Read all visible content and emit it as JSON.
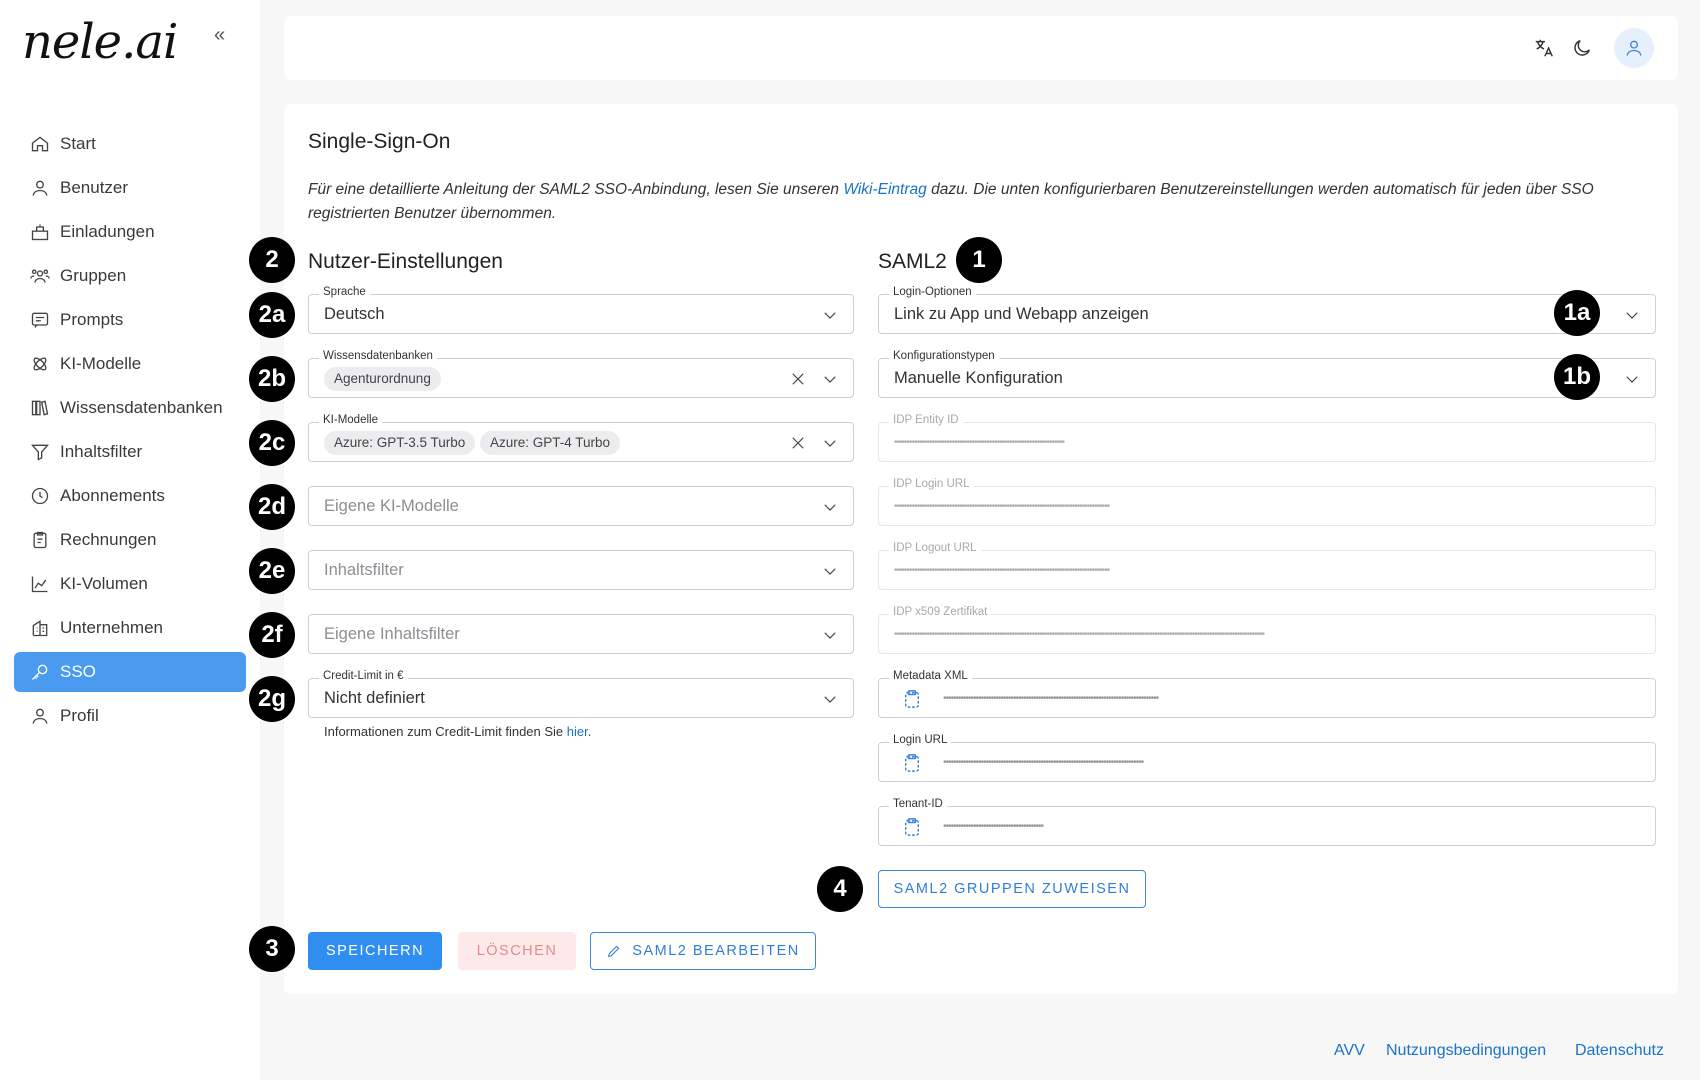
{
  "app": {
    "logo_text": "nele.ai",
    "collapse_glyph": "«"
  },
  "sidebar": {
    "items": [
      {
        "label": "Start",
        "icon": "home-icon"
      },
      {
        "label": "Benutzer",
        "icon": "user-icon"
      },
      {
        "label": "Einladungen",
        "icon": "invite-icon"
      },
      {
        "label": "Gruppen",
        "icon": "group-icon"
      },
      {
        "label": "Prompts",
        "icon": "prompt-icon"
      },
      {
        "label": "KI-Modelle",
        "icon": "model-icon"
      },
      {
        "label": "Wissensdatenbanken",
        "icon": "books-icon"
      },
      {
        "label": "Inhaltsfilter",
        "icon": "filter-icon"
      },
      {
        "label": "Abonnements",
        "icon": "clock-icon"
      },
      {
        "label": "Rechnungen",
        "icon": "invoice-icon"
      },
      {
        "label": "KI-Volumen",
        "icon": "chart-icon"
      },
      {
        "label": "Unternehmen",
        "icon": "building-icon"
      },
      {
        "label": "SSO",
        "icon": "key-icon",
        "active": true
      },
      {
        "label": "Profil",
        "icon": "profile-icon"
      }
    ]
  },
  "topbar": {
    "icons": [
      "translate-icon",
      "moon-icon",
      "user-avatar-icon"
    ]
  },
  "page": {
    "title": "Single-Sign-On",
    "desc_before": "Für eine detaillierte Anleitung der SAML2 SSO-Anbindung, lesen Sie unseren ",
    "desc_link": "Wiki-Eintrag",
    "desc_after": " dazu. Die unten konfigurierbaren Benutzereinstellungen werden automatisch für jeden über SSO registrierten Benutzer übernommen."
  },
  "user_settings": {
    "title": "Nutzer-Einstellungen",
    "sprache": {
      "label": "Sprache",
      "value": "Deutsch"
    },
    "wissensdatenbanken": {
      "label": "Wissensdatenbanken",
      "chips": [
        "Agenturordnung"
      ]
    },
    "ki_modelle": {
      "label": "KI-Modelle",
      "chips": [
        "Azure: GPT-3.5 Turbo",
        "Azure: GPT-4 Turbo"
      ]
    },
    "eigene_ki_modelle": {
      "placeholder": "Eigene KI-Modelle"
    },
    "inhaltsfilter": {
      "placeholder": "Inhaltsfilter"
    },
    "eigene_inhaltsfilter": {
      "placeholder": "Eigene Inhaltsfilter"
    },
    "credit_limit": {
      "label": "Credit-Limit in €",
      "value": "Nicht definiert"
    },
    "helper_before": "Informationen zum Credit-Limit finden Sie ",
    "helper_link": "hier",
    "helper_after": "."
  },
  "saml2": {
    "title": "SAML2",
    "login_optionen": {
      "label": "Login-Optionen",
      "value": "Link zu App und Webapp anzeigen"
    },
    "konfigurationstypen": {
      "label": "Konfigurationstypen",
      "value": "Manuelle Konfiguration"
    },
    "idp_entity_id": {
      "label": "IDP Entity ID",
      "value": "••••••••••••••••••••••••••••••••••••••••••••••••••••••••••••••••••••"
    },
    "idp_login_url": {
      "label": "IDP Login URL",
      "value": "••••••••••••••••••••••••••••••••••••••••••••••••••••••••••••••••••••••••••••••••••••••"
    },
    "idp_logout_url": {
      "label": "IDP Logout URL",
      "value": "••••••••••••••••••••••••••••••••••••••••••••••••••••••••••••••••••••••••••••••••••••••"
    },
    "idp_x509": {
      "label": "IDP x509 Zertifikat",
      "value": "••••••••••••••••••••••••••••••••••••••••••••••••••••••••••••••••••••••••••••••••••••••••••••••••••••••••••••••••••••••••••••••••••••••••••••••••••••"
    },
    "metadata_xml": {
      "label": "Metadata XML",
      "value": "••••••••••••••••••••••••••••••••••••••••••••••••••••••••••••••••••••••••••••••••••••••"
    },
    "login_url": {
      "label": "Login URL",
      "value": "••••••••••••••••••••••••••••••••••••••••••••••••••••••••••••••••••••••••••••••••"
    },
    "tenant_id": {
      "label": "Tenant-ID",
      "value": "••••••••••••••••••••••••••••••••••••••••"
    }
  },
  "buttons": {
    "assign_groups": "SAML2 GRUPPEN ZUWEISEN",
    "save": "SPEICHERN",
    "delete": "LÖSCHEN",
    "edit_saml2": "SAML2 BEARBEITEN"
  },
  "badges": {
    "b1": "1",
    "b1a": "1a",
    "b1b": "1b",
    "b2": "2",
    "b2a": "2a",
    "b2b": "2b",
    "b2c": "2c",
    "b2d": "2d",
    "b2e": "2e",
    "b2f": "2f",
    "b2g": "2g",
    "b3": "3",
    "b4": "4"
  },
  "footer": {
    "avv": "AVV",
    "terms": "Nutzungsbedingungen",
    "privacy": "Datenschutz"
  }
}
